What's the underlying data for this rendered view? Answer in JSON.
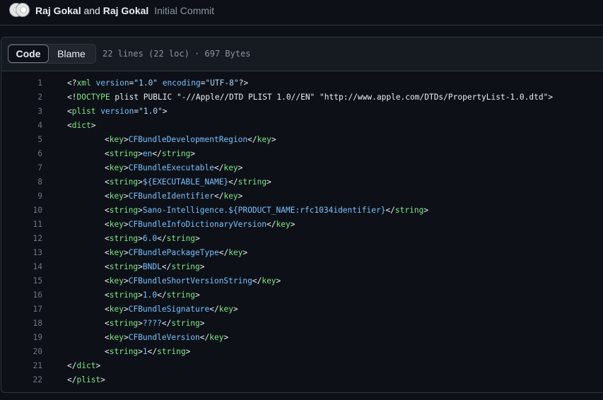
{
  "commit": {
    "author1": "Raj Gokal",
    "conj": "and",
    "author2": "Raj Gokal",
    "message": "Initial Commit"
  },
  "file": {
    "tab_code": "Code",
    "tab_blame": "Blame",
    "info": "22 lines (22 loc) · 697 Bytes"
  },
  "lines": [
    {
      "n": "1",
      "t": "<?xml version=\"1.0\" encoding=\"UTF-8\"?>"
    },
    {
      "n": "2",
      "t": "<!DOCTYPE plist PUBLIC \"-//Apple//DTD PLIST 1.0//EN\" \"http://www.apple.com/DTDs/PropertyList-1.0.dtd\">"
    },
    {
      "n": "3",
      "t": "<plist version=\"1.0\">"
    },
    {
      "n": "4",
      "t": "<dict>"
    },
    {
      "n": "5",
      "t": "<key>CFBundleDevelopmentRegion</key>"
    },
    {
      "n": "6",
      "t": "<string>en</string>"
    },
    {
      "n": "7",
      "t": "<key>CFBundleExecutable</key>"
    },
    {
      "n": "8",
      "t": "<string>${EXECUTABLE_NAME}</string>"
    },
    {
      "n": "9",
      "t": "<key>CFBundleIdentifier</key>"
    },
    {
      "n": "10",
      "t": "<string>Sano-Intelligence.${PRODUCT_NAME:rfc1034identifier}</string>"
    },
    {
      "n": "11",
      "t": "<key>CFBundleInfoDictionaryVersion</key>"
    },
    {
      "n": "12",
      "t": "<string>6.0</string>"
    },
    {
      "n": "13",
      "t": "<key>CFBundlePackageType</key>"
    },
    {
      "n": "14",
      "t": "<string>BNDL</string>"
    },
    {
      "n": "15",
      "t": "<key>CFBundleShortVersionString</key>"
    },
    {
      "n": "16",
      "t": "<string>1.0</string>"
    },
    {
      "n": "17",
      "t": "<key>CFBundleSignature</key>"
    },
    {
      "n": "18",
      "t": "<string>????</string>"
    },
    {
      "n": "19",
      "t": "<key>CFBundleVersion</key>"
    },
    {
      "n": "20",
      "t": "<string>1</string>"
    },
    {
      "n": "21",
      "t": "</dict>"
    },
    {
      "n": "22",
      "t": "</plist>"
    }
  ],
  "colors": {
    "tag": "#7ee787",
    "attr": "#79c0ff",
    "string": "#a5d6ff",
    "key_text": "#79c0ff",
    "line_number": "#6e7681"
  }
}
